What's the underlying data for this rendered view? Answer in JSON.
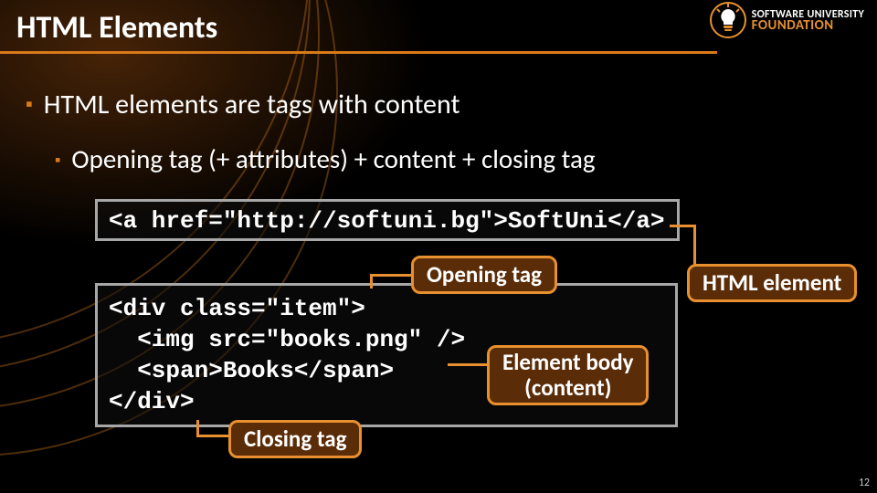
{
  "header": {
    "title": "HTML Elements",
    "logo_line1": "SOFTWARE UNIVERSITY",
    "logo_line2": "FOUNDATION"
  },
  "bullets": {
    "level1": "HTML elements are tags with content",
    "level2": "Opening tag (+ attributes) + content + closing tag"
  },
  "code": {
    "line1": "<a href=\"http://softuni.bg\">SoftUni</a>",
    "block2_l1": "<div class=\"item\">",
    "block2_l2": "  <img src=\"books.png\" />",
    "block2_l3": "  <span>Books</span>",
    "block2_l4": "</div>"
  },
  "callouts": {
    "opening": "Opening tag",
    "html_element": "HTML element",
    "element_body_l1": "Element body",
    "element_body_l2": "(content)",
    "closing": "Closing tag"
  },
  "page_number": "12",
  "colors": {
    "accent": "#d97a1a",
    "callout_bg": "#5b2c08",
    "callout_border": "#e8902f"
  }
}
